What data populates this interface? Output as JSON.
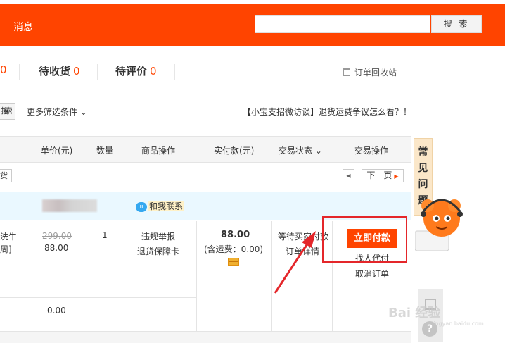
{
  "header": {
    "title": "消息",
    "search_placeholder": "",
    "search_button": "搜 索"
  },
  "tabs": [
    {
      "count": "0"
    },
    {
      "label": "待收货",
      "count": "0"
    },
    {
      "label": "待评价",
      "count": "0"
    }
  ],
  "recycle_label": "订单回收站",
  "filter": {
    "search_button_partial": "搜索",
    "more_filters": "更多筛选条件 ⌄"
  },
  "notice": "【小宝支招微访谈】退货运费争议怎么看？！",
  "table_headers": {
    "price": "单价(元)",
    "qty": "数量",
    "goods_ops": "商品操作",
    "paid": "实付款(元)",
    "status": "交易状态 ⌄",
    "actions": "交易操作"
  },
  "pager": {
    "left_partial": "货",
    "prev": "◀",
    "next": "下一页"
  },
  "order": {
    "contact": "和我联系",
    "contact_icon": "chat-bubble-icon",
    "item_name_line1": "洗牛",
    "item_name_line2": "周]",
    "original_price": "299.00",
    "price": "88.00",
    "quantity": "1",
    "report": "违规举报",
    "guarantee": "退货保障卡",
    "paid_amount": "88.00",
    "shipping": "(含运费：0.00)",
    "status": "等待买家付款",
    "detail": "订单详情",
    "pay_now": "立即付款",
    "proxy_pay": "找人代付",
    "cancel": "取消订单",
    "extra_price": "0.00",
    "extra_qty": "-"
  },
  "side": {
    "faq_chars": [
      "常",
      "见",
      "问",
      "题"
    ]
  },
  "watermark": {
    "main": "Bai 经验",
    "sub": "jingyan.baidu.com"
  },
  "colors": {
    "brand": "#ff4400",
    "highlight": "#e4262a"
  }
}
